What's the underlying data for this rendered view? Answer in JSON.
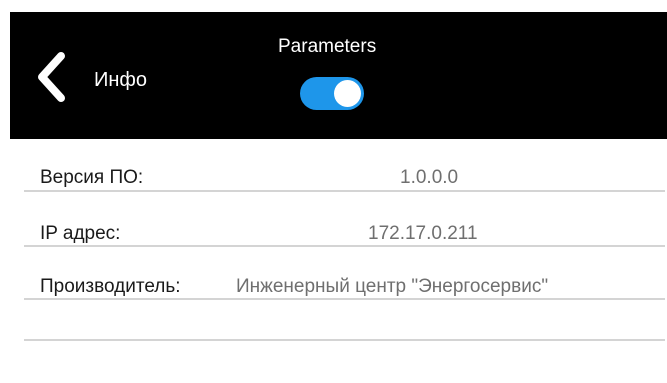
{
  "header": {
    "title": "Инфо",
    "toggle_label": "Parameters",
    "toggle_on": true,
    "back_icon": "chevron-left-icon",
    "accent_color": "#1e96ea"
  },
  "info": {
    "rows": [
      {
        "label": "Версия ПО:",
        "value": "1.0.0.0"
      },
      {
        "label": "IP адрес:",
        "value": "172.17.0.211"
      },
      {
        "label": "Производитель:",
        "value": "Инженерный центр \"Энергосервис\""
      }
    ]
  }
}
